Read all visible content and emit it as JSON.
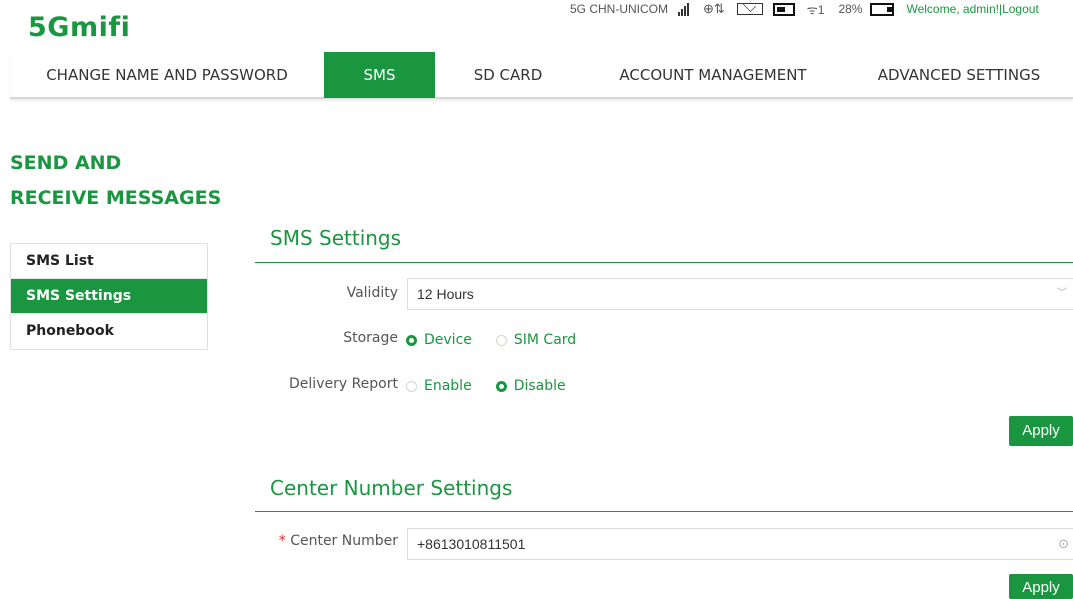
{
  "brand": {
    "logo": "5Gmifi"
  },
  "status": {
    "network": "5G  CHN-UNICOM",
    "battery_pct": "28%",
    "welcome": "Welcome, admin!",
    "separator": "|",
    "logout": "Logout"
  },
  "nav": {
    "tabs": [
      {
        "label": "CHANGE NAME AND PASSWORD"
      },
      {
        "label": "SMS"
      },
      {
        "label": "SD CARD"
      },
      {
        "label": "ACCOUNT MANAGEMENT"
      },
      {
        "label": "ADVANCED SETTINGS"
      }
    ],
    "active": "SMS"
  },
  "page": {
    "title_line1": "SEND AND",
    "title_line2": "RECEIVE MESSAGES"
  },
  "sidebar": {
    "items": [
      {
        "label": "SMS List"
      },
      {
        "label": "SMS Settings"
      },
      {
        "label": "Phonebook"
      }
    ],
    "active": "SMS Settings"
  },
  "sms_settings": {
    "title": "SMS Settings",
    "validity_label": "Validity",
    "validity_value": "12 Hours",
    "storage_label": "Storage",
    "storage_options": [
      "Device",
      "SIM Card"
    ],
    "storage_selected": "Device",
    "delivery_label": "Delivery Report",
    "delivery_options": [
      "Enable",
      "Disable"
    ],
    "delivery_selected": "Disable",
    "apply": "Apply"
  },
  "center_number": {
    "title": "Center Number Settings",
    "required_mark": "*",
    "label": "Center Number",
    "value": "+8613010811501",
    "apply": "Apply"
  },
  "colors": {
    "accent": "#1a9641"
  },
  "icons": [
    "signal-icon",
    "data-transfer-icon",
    "mail-icon",
    "sim-icon",
    "wifi-icon",
    "battery-icon",
    "chevron-down-icon",
    "check-circle-icon"
  ]
}
